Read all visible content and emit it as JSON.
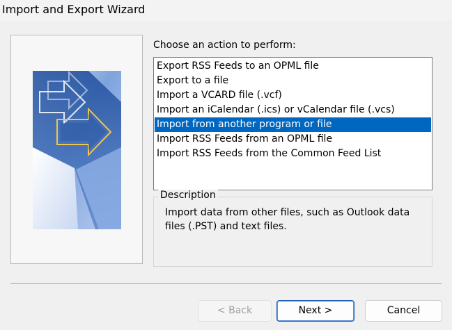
{
  "window": {
    "title": "Import and Export Wizard"
  },
  "main": {
    "prompt": "Choose an action to perform:",
    "actions": [
      {
        "label": "Export RSS Feeds to an OPML file",
        "selected": false
      },
      {
        "label": "Export to a file",
        "selected": false
      },
      {
        "label": "Import a VCARD file (.vcf)",
        "selected": false
      },
      {
        "label": "Import an iCalendar (.ics) or vCalendar file (.vcs)",
        "selected": false
      },
      {
        "label": "Import from another program or file",
        "selected": true
      },
      {
        "label": "Import RSS Feeds from an OPML file",
        "selected": false
      },
      {
        "label": "Import RSS Feeds from the Common Feed List",
        "selected": false
      }
    ],
    "description": {
      "legend": "Description",
      "text": "Import data from other files, such as Outlook data files (.PST) and text files."
    }
  },
  "buttons": {
    "back": "< Back",
    "next": "Next >",
    "cancel": "Cancel"
  },
  "colors": {
    "selection": "#0067c0",
    "art_blue": "#2f5da8"
  }
}
